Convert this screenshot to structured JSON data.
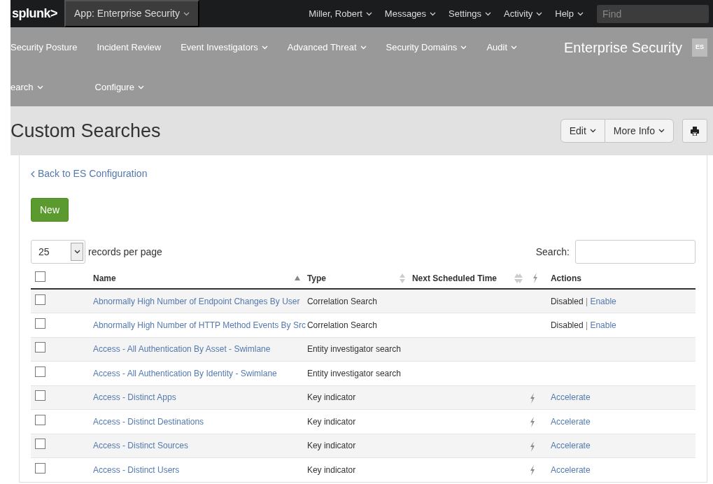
{
  "topbar": {
    "logo": "splunk>",
    "app": {
      "label": "App: Enterprise Security",
      "dropdown": true
    },
    "menus": [
      {
        "label": "Miller, Robert",
        "dropdown": true
      },
      {
        "label": "Messages",
        "dropdown": true
      },
      {
        "label": "Settings",
        "dropdown": true
      },
      {
        "label": "Activity",
        "dropdown": true
      },
      {
        "label": "Help",
        "dropdown": true
      }
    ],
    "find": {
      "placeholder": "Find"
    }
  },
  "appnav": {
    "rows": [
      [
        {
          "label": "Security Posture",
          "dropdown": false
        },
        {
          "label": "Incident Review",
          "dropdown": false
        },
        {
          "label": "Event Investigators",
          "dropdown": true
        },
        {
          "label": "Advanced Threat",
          "dropdown": true
        },
        {
          "label": "Security Domains",
          "dropdown": true
        },
        {
          "label": "Audit",
          "dropdown": true
        }
      ],
      [
        {
          "label": "earch",
          "dropdown": true
        },
        {
          "label": "Configure",
          "dropdown": true
        }
      ]
    ],
    "app_title": "Enterprise Security",
    "app_badge": "ES"
  },
  "page": {
    "title": "Custom Searches",
    "buttons": [
      {
        "label": "Edit",
        "dropdown": true
      },
      {
        "label": "More Info",
        "dropdown": true
      }
    ]
  },
  "back_link": "Back to ES Configuration",
  "new_button": "New",
  "page_size": {
    "value": "25",
    "label": "records per page"
  },
  "search": {
    "label": "Search:"
  },
  "table": {
    "columns": [
      {
        "label": "Name",
        "sortable": true,
        "sorted": true
      },
      {
        "label": "Type",
        "sortable": true,
        "sorted": false
      },
      {
        "label": "Next Scheduled Time",
        "sortable": true,
        "sorted": false
      },
      {
        "kind": "bolt",
        "sortable": true,
        "sorted": false
      },
      {
        "label": "Actions",
        "sortable": false
      }
    ],
    "select_all": {
      "checked": false
    },
    "rows": [
      {
        "checked": false,
        "name": "Abnormally High Number of Endpoint Changes By User",
        "type": "Correlation Search",
        "bolt": false,
        "status": "Disabled",
        "separator": "|",
        "action": "Enable"
      },
      {
        "checked": false,
        "name": "Abnormally High Number of HTTP Method Events By Src",
        "type": "Correlation Search",
        "bolt": false,
        "status": "Disabled",
        "separator": "|",
        "action": "Enable"
      },
      {
        "checked": false,
        "name": "Access - All Authentication By Asset - Swimlane",
        "type": "Entity investigator search",
        "bolt": false
      },
      {
        "checked": false,
        "name": "Access - All Authentication By Identity - Swimlane",
        "type": "Entity investigator search",
        "bolt": false
      },
      {
        "checked": false,
        "name": "Access - Distinct Apps",
        "type": "Key indicator",
        "bolt": true,
        "action": "Accelerate"
      },
      {
        "checked": false,
        "name": "Access - Distinct Destinations",
        "type": "Key indicator",
        "bolt": true,
        "action": "Accelerate"
      },
      {
        "checked": false,
        "name": "Access - Distinct Sources",
        "type": "Key indicator",
        "bolt": true,
        "action": "Accelerate"
      },
      {
        "checked": false,
        "name": "Access - Distinct Users",
        "type": "Key indicator",
        "bolt": true,
        "action": "Accelerate"
      }
    ]
  }
}
